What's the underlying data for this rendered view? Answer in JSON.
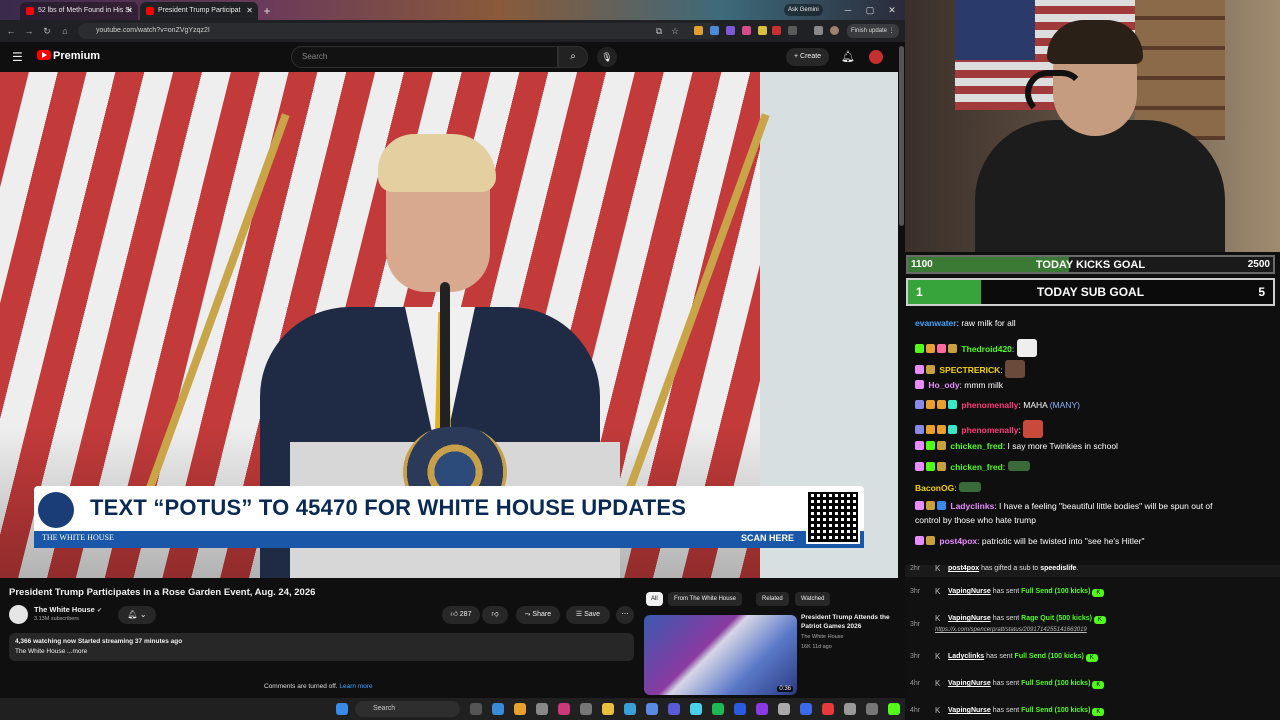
{
  "browser": {
    "tabs": [
      {
        "title": "52 lbs of Meth Found in His Si"
      },
      {
        "title": "President Trump Participat"
      }
    ],
    "ask_gemini": "Ask Gemini",
    "url": "youtube.com/watch?v=onZVgYzqz2I",
    "finish_update": "Finish update"
  },
  "youtube": {
    "logo_text": "Premium",
    "search_placeholder": "Search",
    "create_label": "Create",
    "banner": {
      "headline": "TEXT “POTUS” TO 45470 FOR WHITE HOUSE UPDATES",
      "org": "THE WHITE HOUSE",
      "cta": "SCAN HERE"
    },
    "video": {
      "title": "President Trump Participates in a Rose Garden Event, Aug. 24, 2026",
      "channel": "The White House",
      "subscribers": "3.13M subscribers",
      "likes": "287",
      "share_label": "Share",
      "save_label": "Save",
      "watching_line": "4,366 watching now  Started streaming 37 minutes ago",
      "desc_line": "The White House ...more",
      "comments_off": "Comments are turned off.",
      "learn_more": "Learn more"
    },
    "filter_chips": [
      "All",
      "From The White House",
      "Related",
      "Watched"
    ],
    "recommendation": {
      "title": "President Trump Attends the Patriot Games 2026",
      "channel": "The White House",
      "meta": "16K  11d ago",
      "duration": "0:36"
    }
  },
  "goals": {
    "kicks": {
      "current": "1100",
      "label": "TODAY KICKS GOAL",
      "target": "2500",
      "progress": 0.44
    },
    "subs": {
      "current": "1",
      "label": "TODAY SUB GOAL",
      "target": "5",
      "progress": 0.2
    }
  },
  "chat": [
    {
      "user": "evanwater",
      "color": "#3ea6ff",
      "text": ": raw milk for all"
    },
    {
      "user": "Thedroid420",
      "color": "#53fc18",
      "text": ":"
    },
    {
      "user": "SPECTRERICK",
      "color": "#f5d300",
      "text": ":"
    },
    {
      "user": "Ho_ody",
      "color": "#e88cff",
      "text": ": mmm milk"
    },
    {
      "user": "phenomenally",
      "color": "#ff3b7a",
      "text": ": MAHA",
      "extra": "(MANY)"
    },
    {
      "user": "phenomenally",
      "color": "#ff3b7a",
      "text": ":"
    },
    {
      "user": "chicken_fred",
      "color": "#53fc18",
      "text": ": I say more Twinkies in school"
    },
    {
      "user": "chicken_fred",
      "color": "#53fc18",
      "text": ":"
    },
    {
      "user": "BaconOG",
      "color": "#f5d300",
      "text": ":"
    },
    {
      "user": "Ladyclinks",
      "color": "#e88cff",
      "text": ": I have a feeling \"beautiful little bodies\" will be spun out of",
      "line2": "control by those who hate trump"
    },
    {
      "user": "post4pox",
      "color": "#e88cff",
      "text": ": patriotic will be twisted into \"see he's Hitler\""
    }
  ],
  "events": [
    {
      "time": "2hr",
      "who": "post4pox",
      "action": " has gifted a sub to ",
      "what": "speedislife",
      "suffix": "."
    },
    {
      "time": "3hr",
      "who": "VapingNurse",
      "action": " has sent ",
      "what": "Full Send (100 kicks)"
    },
    {
      "time": "3hr",
      "who": "VapingNurse",
      "action": " has sent ",
      "what": "Rage Quit (500 kicks)",
      "link": "https://x.com/spencerpratt/status/2091714255141663019"
    },
    {
      "time": "3hr",
      "who": "Ladyclinks",
      "action": " has sent ",
      "what": "Full Send (100 kicks)"
    },
    {
      "time": "4hr",
      "who": "VapingNurse",
      "action": " has sent ",
      "what": "Full Send (100 kicks)"
    },
    {
      "time": "4hr",
      "who": "VapingNurse",
      "action": " has sent ",
      "what": "Full Send (100 kicks)"
    }
  ],
  "taskbar": {
    "search_placeholder": "Search"
  }
}
